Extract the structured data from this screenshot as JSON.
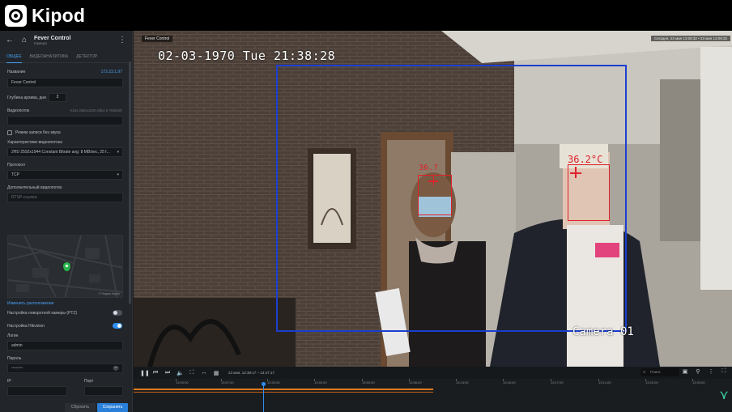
{
  "brand": {
    "name": "Kipod"
  },
  "sidebar": {
    "title": "Fever Control",
    "subtitle": "Камера",
    "tabs": [
      "Общее",
      "Видеоаналитика",
      "Детектор"
    ],
    "name_label": "Название",
    "ip": "172.23.1.97",
    "name_value": "Fever Control",
    "depth_label": "Глубина архива, дни",
    "depth_value": "2",
    "stream_label": "Видеопоток",
    "stream_hint": "H264 2560x1920 25fps 6 794kbit/s",
    "stream_value": "",
    "no_audio_label": "Режим записи без звука",
    "stream_char_label": "Характеристики видеопотока",
    "stream_char_value": "2HD 2592x1944 Constant Bitrate avg: 8 MB/sec, 25 f...",
    "protocol_label": "Протокол",
    "protocol_value": "TCP",
    "extra_stream_label": "Дополнительный видеопоток",
    "extra_stream_placeholder": "RTSP-ссылка",
    "map_credit": "© Яндекс.Карты",
    "change_location": "Изменить расположение",
    "ptz_label": "Настройка поворотной камеры (PTZ)",
    "hikvision_label": "Настройка Hikvision",
    "login_label": "Логин",
    "login_value": "admin",
    "password_label": "Пароль",
    "password_value": "••••••••",
    "ip_label": "IP",
    "port_label": "Порт",
    "reset_button": "Сбросить",
    "save_button": "Сохранить"
  },
  "viewer": {
    "camera_label": "Fever Control",
    "top_right": "Сегодня, 23 мая 13:09:32 • 23 мая 13:09:32",
    "osd_time": "02-03-1970 Tue 21:38:28",
    "osd_camera": "Camera 01",
    "temp1": "36.?",
    "temp2": "36.2°C"
  },
  "player": {
    "date_range": "23 мая, 12:38:17 – 13:47:17",
    "search_placeholder": "Поиск"
  },
  "timeline": {
    "ticks": [
      "13:00:00",
      "13:07:00",
      "13:30:00",
      "13:40:00",
      "13:50:00",
      "13:56:00",
      "13:13:00",
      "13:16:00",
      "13:17:00",
      "13:14:00",
      "13:20:00",
      "13:33:00"
    ]
  },
  "colors": {
    "accent": "#2f8ef0",
    "roi": "#1a3fd0",
    "face_box": "#e0202a",
    "timeline_record": "#e07a1a"
  }
}
